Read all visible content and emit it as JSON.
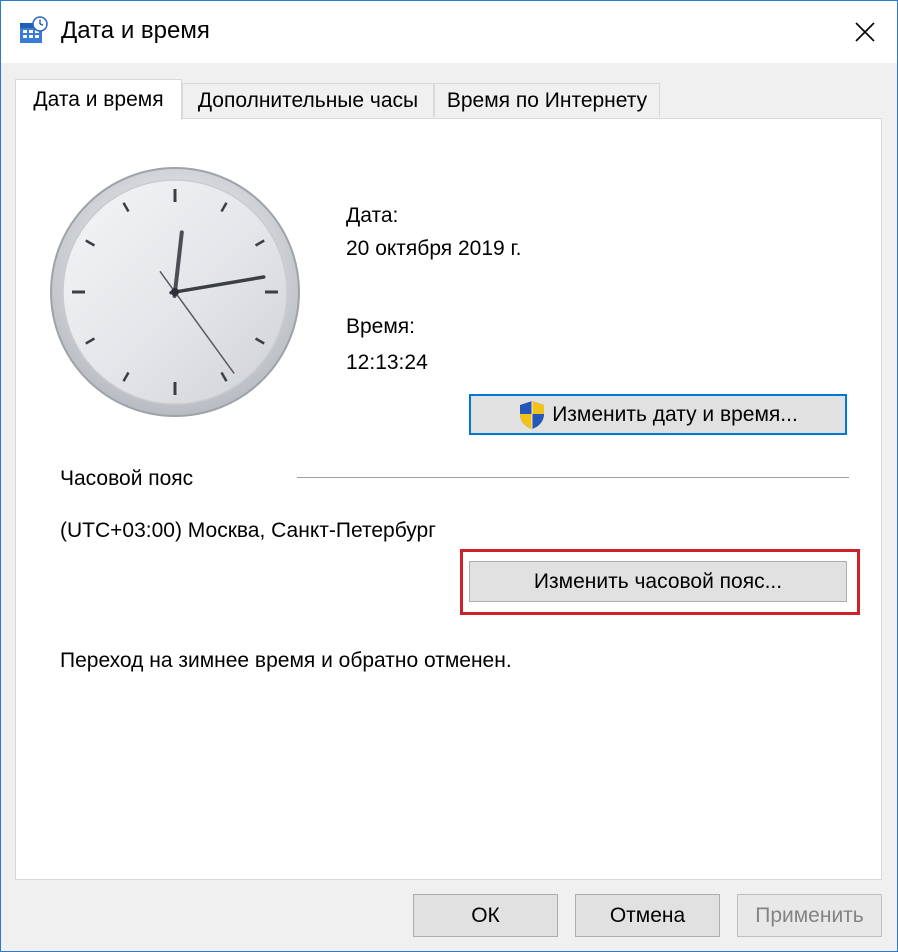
{
  "window": {
    "title": "Дата и время",
    "app_icon": "date-time-icon",
    "close_icon": "close-icon"
  },
  "tabs": [
    {
      "label": "Дата и время",
      "active": true
    },
    {
      "label": "Дополнительные часы",
      "active": false
    },
    {
      "label": "Время по Интернету",
      "active": false
    }
  ],
  "clock": {
    "hour": 12,
    "minute": 13,
    "second": 24
  },
  "date": {
    "label": "Дата:",
    "value": "20 октября 2019 г."
  },
  "time": {
    "label": "Время:",
    "value": "12:13:24"
  },
  "change_datetime_button": {
    "label": "Изменить дату и время...",
    "icon": "uac-shield-icon"
  },
  "timezone": {
    "section_label": "Часовой пояс",
    "value": "(UTC+03:00) Москва, Санкт-Петербург",
    "change_button": "Изменить часовой пояс..."
  },
  "dst_note": "Переход на зимнее время и обратно отменен.",
  "footer": {
    "ok": "ОК",
    "cancel": "Отмена",
    "apply": "Применить"
  },
  "colors": {
    "accent": "#0078d7",
    "highlight": "#d0202a"
  }
}
